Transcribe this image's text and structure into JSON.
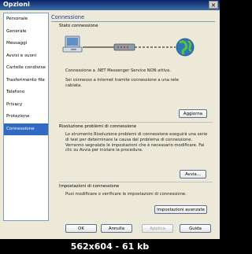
{
  "window": {
    "title": "Opzioni",
    "close_glyph": "×"
  },
  "sidebar": {
    "items": [
      {
        "label": "Personale"
      },
      {
        "label": "Generale"
      },
      {
        "label": "Messaggi"
      },
      {
        "label": "Avvisi e suoni"
      },
      {
        "label": "Cartelle condivise"
      },
      {
        "label": "Trasferimento file"
      },
      {
        "label": "Telefono"
      },
      {
        "label": "Privacy"
      },
      {
        "label": "Protezione"
      },
      {
        "label": "Connessione"
      }
    ],
    "selected_index": 9
  },
  "main": {
    "header": "Connessione",
    "status_group": "Stato connessione",
    "status_line1": "Connessione a .NET Messenger Service NON attiva.",
    "status_line2": "Sei connesso a Internet tramite connessione a una rete cablata.",
    "refresh_button": "Aggiorna",
    "troubleshoot_group": "Risoluzione problemi di connessione",
    "troubleshoot_text": "Lo strumento Risoluzione problemi di connessione eseguirà una serie di test per determinare la causa del problema di connessione. Verranno segnalate le impostazioni che è necessario modificare. Fai clic su Avvia per iniziare la procedura.",
    "start_button": "Avvia...",
    "settings_group": "Impostazioni di connessione",
    "settings_text": "Puoi modificare o verificare le impostazioni di connessione.",
    "advanced_button": "Impostazioni avanzate"
  },
  "footer": {
    "ok": "OK",
    "cancel": "Annulla",
    "apply": "Applica",
    "help": "Guida"
  },
  "caption": "562x604 - 61 kb",
  "colors": {
    "accent": "#316ac5",
    "header": "#1e3c8e",
    "internet": "#2a7ab5"
  }
}
